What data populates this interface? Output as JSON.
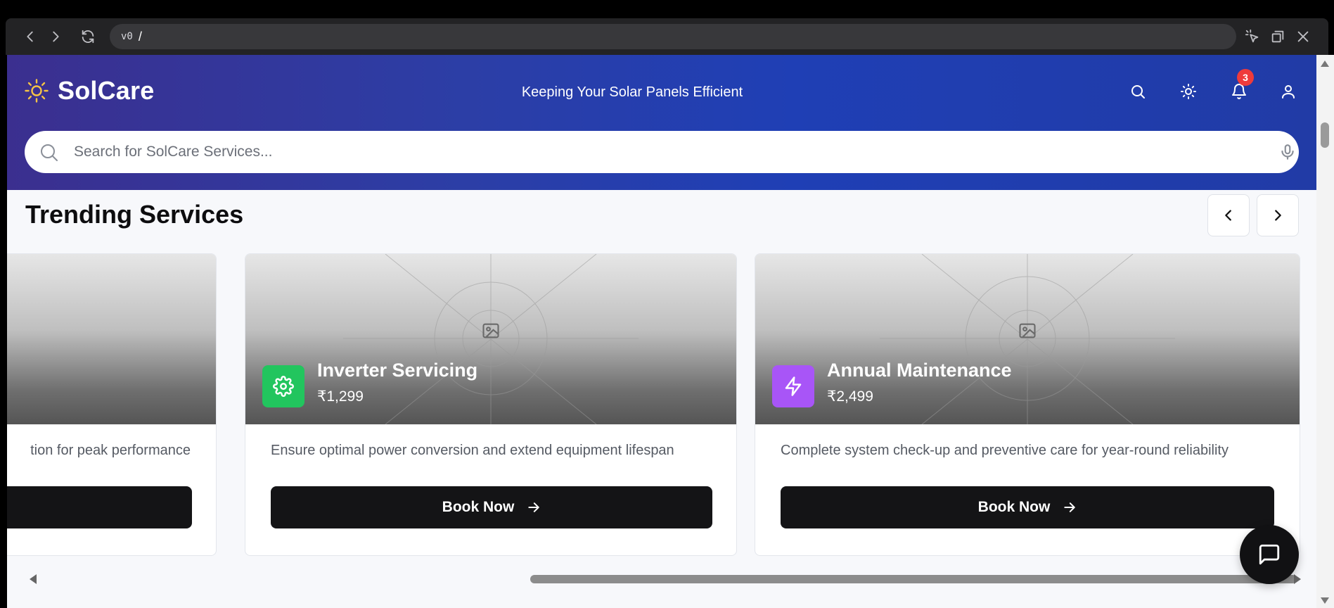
{
  "browser": {
    "url_prefix": "v0",
    "url_path": "/"
  },
  "header": {
    "brand": "SolCare",
    "tagline": "Keeping Your Solar Panels Efficient",
    "notification_count": "3",
    "search_placeholder": "Search for SolCare Services..."
  },
  "trending": {
    "title": "Trending Services",
    "cards": [
      {
        "name": "",
        "price": "",
        "description": "tion for peak performance",
        "button_label": ""
      },
      {
        "name": "Inverter Servicing",
        "price": "₹1,299",
        "description": "Ensure optimal power conversion and extend equipment lifespan",
        "button_label": "Book Now",
        "icon": "gear-icon",
        "icon_color": "#22c55e"
      },
      {
        "name": "Annual Maintenance",
        "price": "₹2,499",
        "description": "Complete system check-up and preventive care for year-round reliability",
        "button_label": "Book Now",
        "icon": "bolt-icon",
        "icon_color": "#a855f7"
      }
    ]
  },
  "colors": {
    "header_gradient_start": "#3b2f8f",
    "header_gradient_end": "#213ba6",
    "badge": "#ef3b3b",
    "logo_sun": "#f6c445",
    "button_dark": "#141416"
  }
}
